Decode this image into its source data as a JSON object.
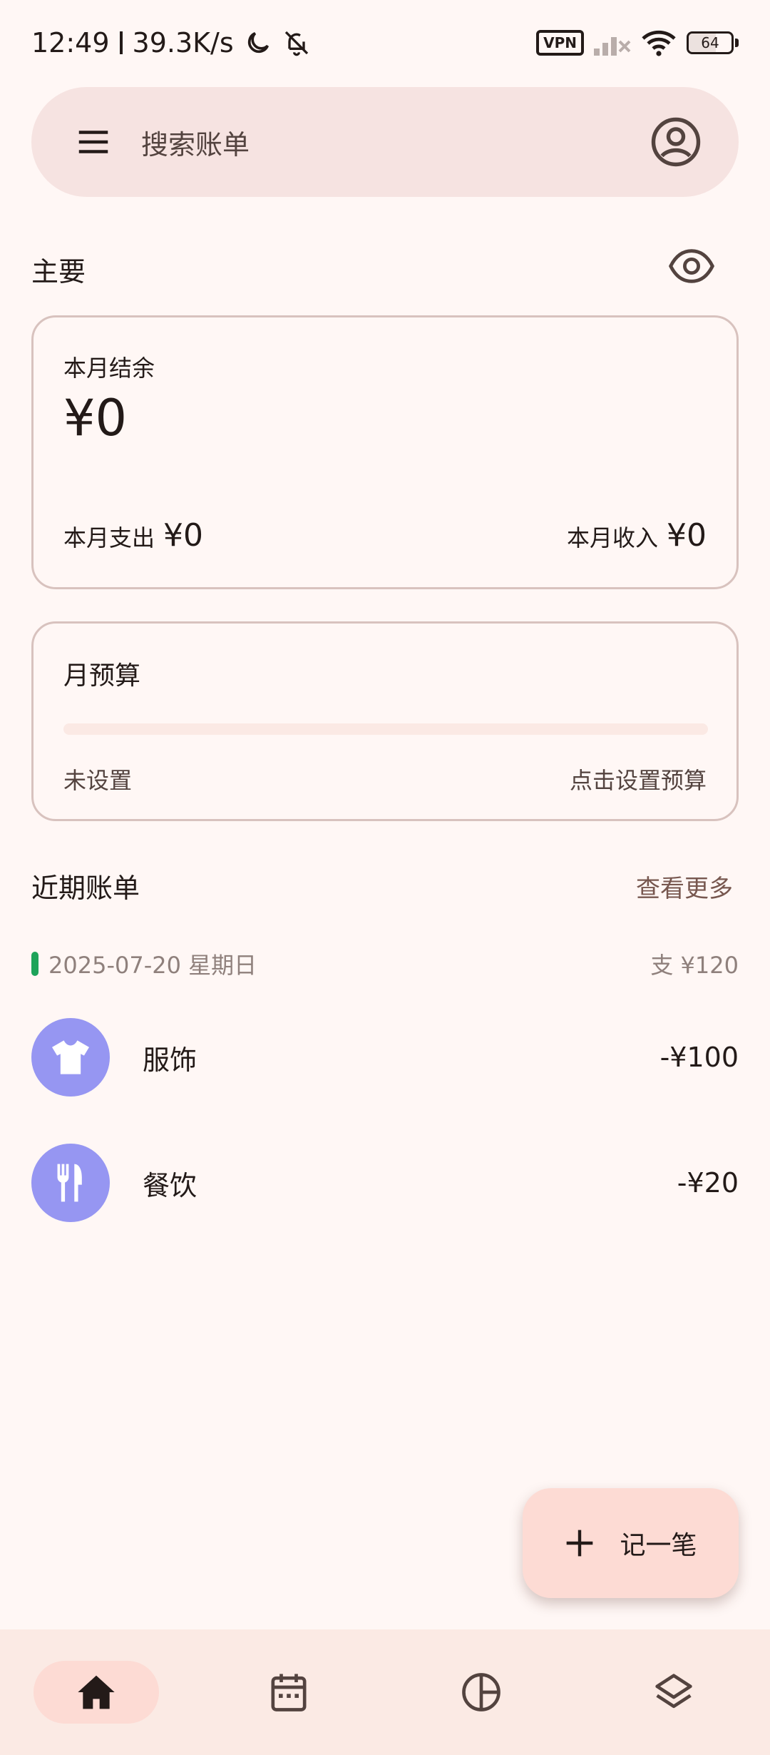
{
  "status_bar": {
    "time": "12:49",
    "network_speed": "39.3K/s",
    "vpn_label": "VPN",
    "battery_level": "64"
  },
  "search": {
    "placeholder": "搜索账单"
  },
  "main_section": {
    "title": "主要"
  },
  "balance_card": {
    "balance_label": "本月结余",
    "balance_value": "¥0",
    "expense_label": "本月支出",
    "expense_value": "¥0",
    "income_label": "本月收入",
    "income_value": "¥0"
  },
  "budget_card": {
    "title": "月预算",
    "progress": 0,
    "status": "未设置",
    "action": "点击设置预算"
  },
  "recent_bills": {
    "title": "近期账单",
    "more_label": "查看更多",
    "date_group": {
      "date": "2025-07-20 星期日",
      "summary": "支 ¥120"
    },
    "items": [
      {
        "name": "服饰",
        "amount": "-¥100",
        "icon": "tshirt-icon"
      },
      {
        "name": "餐饮",
        "amount": "-¥20",
        "icon": "fork-knife-icon"
      }
    ]
  },
  "fab": {
    "label": "记一笔"
  },
  "bottom_nav": {
    "items": [
      {
        "icon": "home-icon",
        "active": true
      },
      {
        "icon": "calendar-icon",
        "active": false
      },
      {
        "icon": "pie-chart-icon",
        "active": false
      },
      {
        "icon": "layers-icon",
        "active": false
      }
    ]
  },
  "colors": {
    "background": "#FFF7F5",
    "search_bg": "#F6E3E1",
    "accent_container": "#FDDBD4",
    "category_icon_bg": "#9696F2",
    "date_marker": "#1DA35A",
    "link": "#77574F"
  }
}
